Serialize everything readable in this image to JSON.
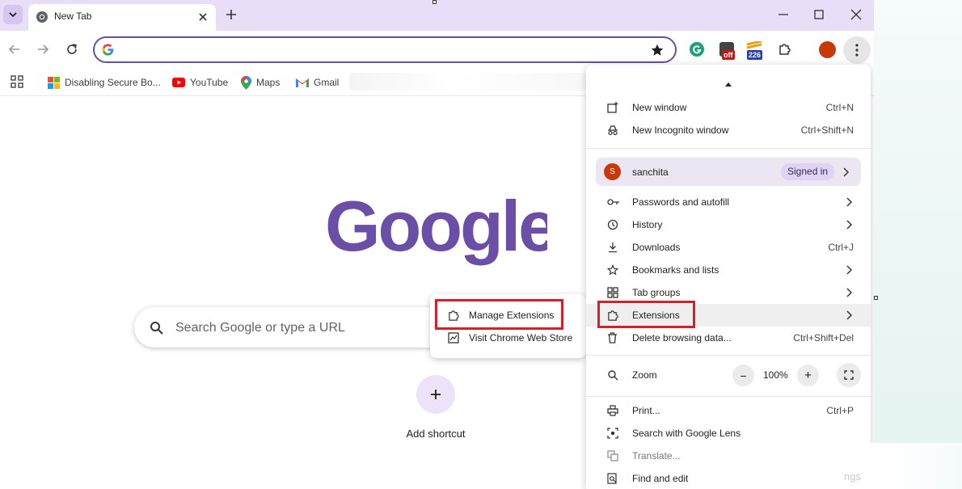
{
  "tab": {
    "title": "New Tab"
  },
  "omnibox": {
    "value": ""
  },
  "toolbar": {
    "ext_badge_off": "off",
    "ext_badge_count": "226"
  },
  "bookmarks": [
    {
      "label": "Disabling Secure Bo...",
      "icon": "microsoft-icon"
    },
    {
      "label": "YouTube",
      "icon": "youtube-icon"
    },
    {
      "label": "Maps",
      "icon": "maps-icon"
    },
    {
      "label": "Gmail",
      "icon": "gmail-icon"
    }
  ],
  "page": {
    "logo_text": "Google",
    "search_placeholder": "Search Google or type a URL",
    "add_shortcut": "Add shortcut"
  },
  "submenu": {
    "items": [
      {
        "label": "Manage Extensions",
        "icon": "puzzle-icon",
        "highlighted": true
      },
      {
        "label": "Visit Chrome Web Store",
        "icon": "store-icon"
      }
    ]
  },
  "menu": {
    "new_window": {
      "label": "New window",
      "shortcut": "Ctrl+N"
    },
    "incognito": {
      "label": "New Incognito window",
      "shortcut": "Ctrl+Shift+N"
    },
    "profile": {
      "name": "sanchita",
      "initial": "S",
      "status": "Signed in"
    },
    "passwords": {
      "label": "Passwords and autofill"
    },
    "history": {
      "label": "History"
    },
    "downloads": {
      "label": "Downloads",
      "shortcut": "Ctrl+J"
    },
    "bookmarks": {
      "label": "Bookmarks and lists"
    },
    "tab_groups": {
      "label": "Tab groups"
    },
    "extensions": {
      "label": "Extensions",
      "highlighted": true
    },
    "delete_data": {
      "label": "Delete browsing data...",
      "shortcut": "Ctrl+Shift+Del"
    },
    "zoom": {
      "label": "Zoom",
      "minus": "−",
      "value": "100%",
      "plus": "+"
    },
    "print": {
      "label": "Print...",
      "shortcut": "Ctrl+P"
    },
    "lens": {
      "label": "Search with Google Lens"
    },
    "translate": {
      "label": "Translate..."
    },
    "find": {
      "label": "Find and edit"
    },
    "settings_fragment": "ngs"
  },
  "colors": {
    "accent": "#6a4fa0",
    "tabstrip": "#e8def8",
    "highlight_box": "#d81e28",
    "profile": "#c5390b"
  }
}
